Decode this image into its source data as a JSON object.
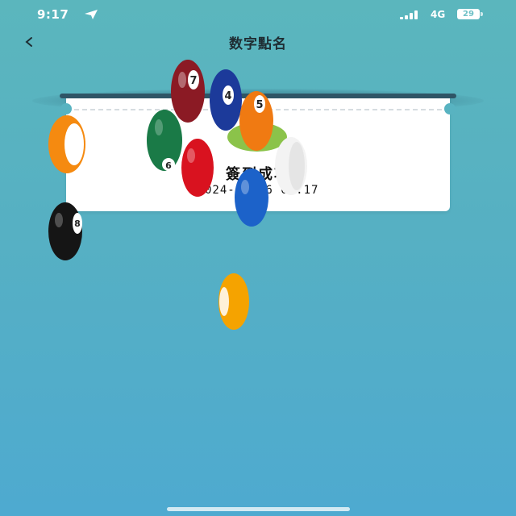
{
  "status_bar": {
    "time": "9:17",
    "network": "4G",
    "battery": "29",
    "icons": [
      "location-arrow-icon",
      "signal-icon",
      "battery-icon"
    ]
  },
  "nav": {
    "back_label": "<",
    "title": "数字點名"
  },
  "ticket": {
    "success_text": "簽到成功",
    "timestamp": "2024-04-06 09:17"
  },
  "balls": [
    {
      "number": "7",
      "color": "#8b1a24"
    },
    {
      "number": "4",
      "color": "#1c3a9a"
    },
    {
      "number": "5",
      "color": "#f07a12"
    },
    {
      "number": "6",
      "color": "#1a7a47"
    },
    {
      "number": "",
      "color": "#d9121f"
    },
    {
      "number": "",
      "color": "#f3f3f3"
    },
    {
      "number": "",
      "color": "#1c62c9"
    },
    {
      "number": "",
      "color": "#f58a10"
    },
    {
      "number": "8",
      "color": "#151515"
    },
    {
      "number": "",
      "color": "#f5a300"
    }
  ],
  "colors": {
    "background_top": "#5bb6bd",
    "background_bottom": "#4eaad0",
    "card": "#ffffff",
    "slot": "#2f5566",
    "ball_accent_green": "#8bc34a"
  }
}
